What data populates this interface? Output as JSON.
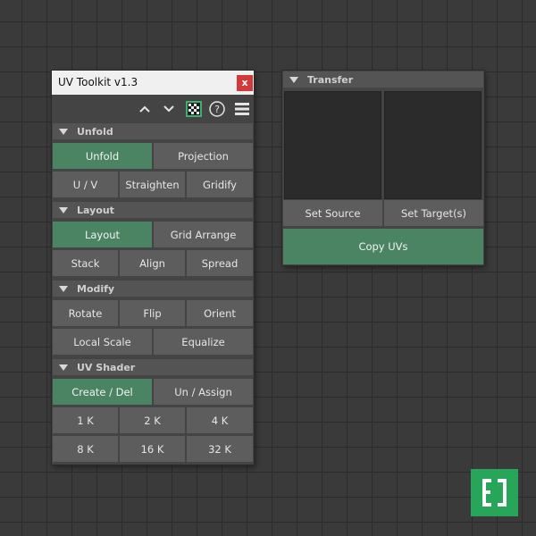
{
  "toolkit": {
    "title": "UV Toolkit v1.3",
    "close_label": "x",
    "toolbar_icons": [
      "chevron-up-icon",
      "chevron-down-icon",
      "checker-icon",
      "help-icon",
      "menu-icon"
    ],
    "toolbar": {
      "help_label": "?"
    },
    "sections": {
      "unfold": {
        "label": "Unfold",
        "buttons": [
          "Unfold",
          "Projection",
          "U / V",
          "Straighten",
          "Gridify"
        ]
      },
      "layout": {
        "label": "Layout",
        "buttons": [
          "Layout",
          "Grid Arrange",
          "Stack",
          "Align",
          "Spread"
        ]
      },
      "modify": {
        "label": "Modify",
        "buttons": [
          "Rotate",
          "Flip",
          "Orient",
          "Local Scale",
          "Equalize"
        ]
      },
      "uv_shader": {
        "label": "UV Shader",
        "buttons": [
          "Create / Del",
          "Un / Assign",
          "1 K",
          "2 K",
          "4 K",
          "8 K",
          "16 K",
          "32 K"
        ]
      }
    }
  },
  "transfer": {
    "label": "Transfer",
    "set_source": "Set Source",
    "set_targets": "Set Target(s)",
    "copy_uvs": "Copy UVs"
  },
  "colors": {
    "active_button": "#4a8463",
    "button": "#5d5d5d",
    "logo_green": "#27a65a",
    "close_red": "#d23a3a"
  }
}
